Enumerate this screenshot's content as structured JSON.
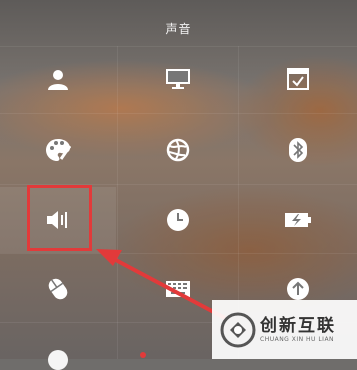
{
  "window": {
    "title": "声音"
  },
  "tiles": [
    {
      "icon": "user-icon"
    },
    {
      "icon": "display-icon"
    },
    {
      "icon": "window-check-icon"
    },
    {
      "icon": "personalization-palette-icon"
    },
    {
      "icon": "network-globe-icon"
    },
    {
      "icon": "bluetooth-icon"
    },
    {
      "icon": "sound-speaker-icon",
      "selected": true
    },
    {
      "icon": "clock-icon"
    },
    {
      "icon": "power-battery-icon"
    },
    {
      "icon": "mouse-icon"
    },
    {
      "icon": "keyboard-icon"
    },
    {
      "icon": "update-arrow-up-icon"
    }
  ],
  "annotation": {
    "color": "#e23a3a"
  },
  "watermark": {
    "cn": "创新互联",
    "en": "CHUANG XIN HU LIAN"
  }
}
